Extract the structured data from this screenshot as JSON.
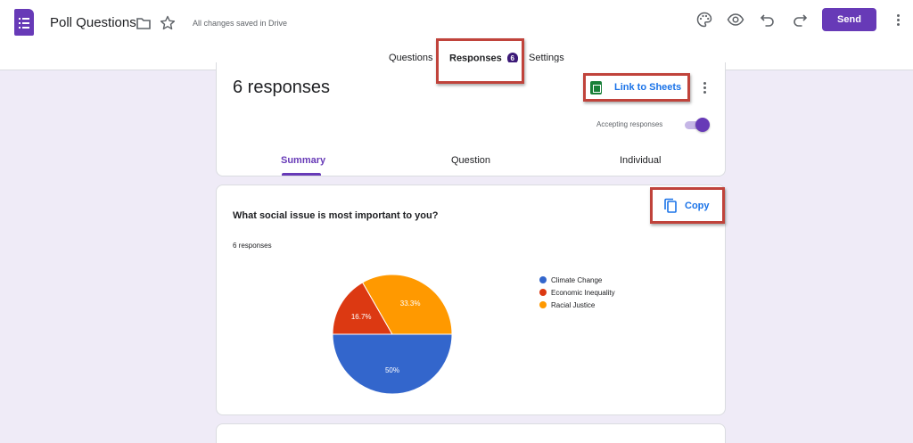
{
  "header": {
    "title": "Poll Questions",
    "save_status": "All changes saved in Drive",
    "send_label": "Send"
  },
  "tabs": [
    {
      "label": "Questions"
    },
    {
      "label": "Responses",
      "badge": "6"
    },
    {
      "label": "Settings"
    }
  ],
  "summary_card": {
    "responses_heading": "6 responses",
    "link_to_sheets": "Link to Sheets",
    "accepting_label": "Accepting responses",
    "accepting_on": true,
    "subtabs": [
      "Summary",
      "Question",
      "Individual"
    ]
  },
  "question_card": {
    "title": "What social issue is most important to you?",
    "responses": "6 responses",
    "copy_label": "Copy"
  },
  "colors": {
    "accent": "#673ab7",
    "highlight": "#c0433b",
    "link": "#1a73e8"
  },
  "chart_data": {
    "type": "pie",
    "categories": [
      "Climate Change",
      "Economic Inequality",
      "Racial Justice"
    ],
    "values": [
      50,
      16.7,
      33.3
    ],
    "labels": [
      "50%",
      "16.7%",
      "33.3%"
    ],
    "colors": [
      "#3366cc",
      "#dc3912",
      "#ff9900"
    ],
    "legend_position": "right"
  }
}
